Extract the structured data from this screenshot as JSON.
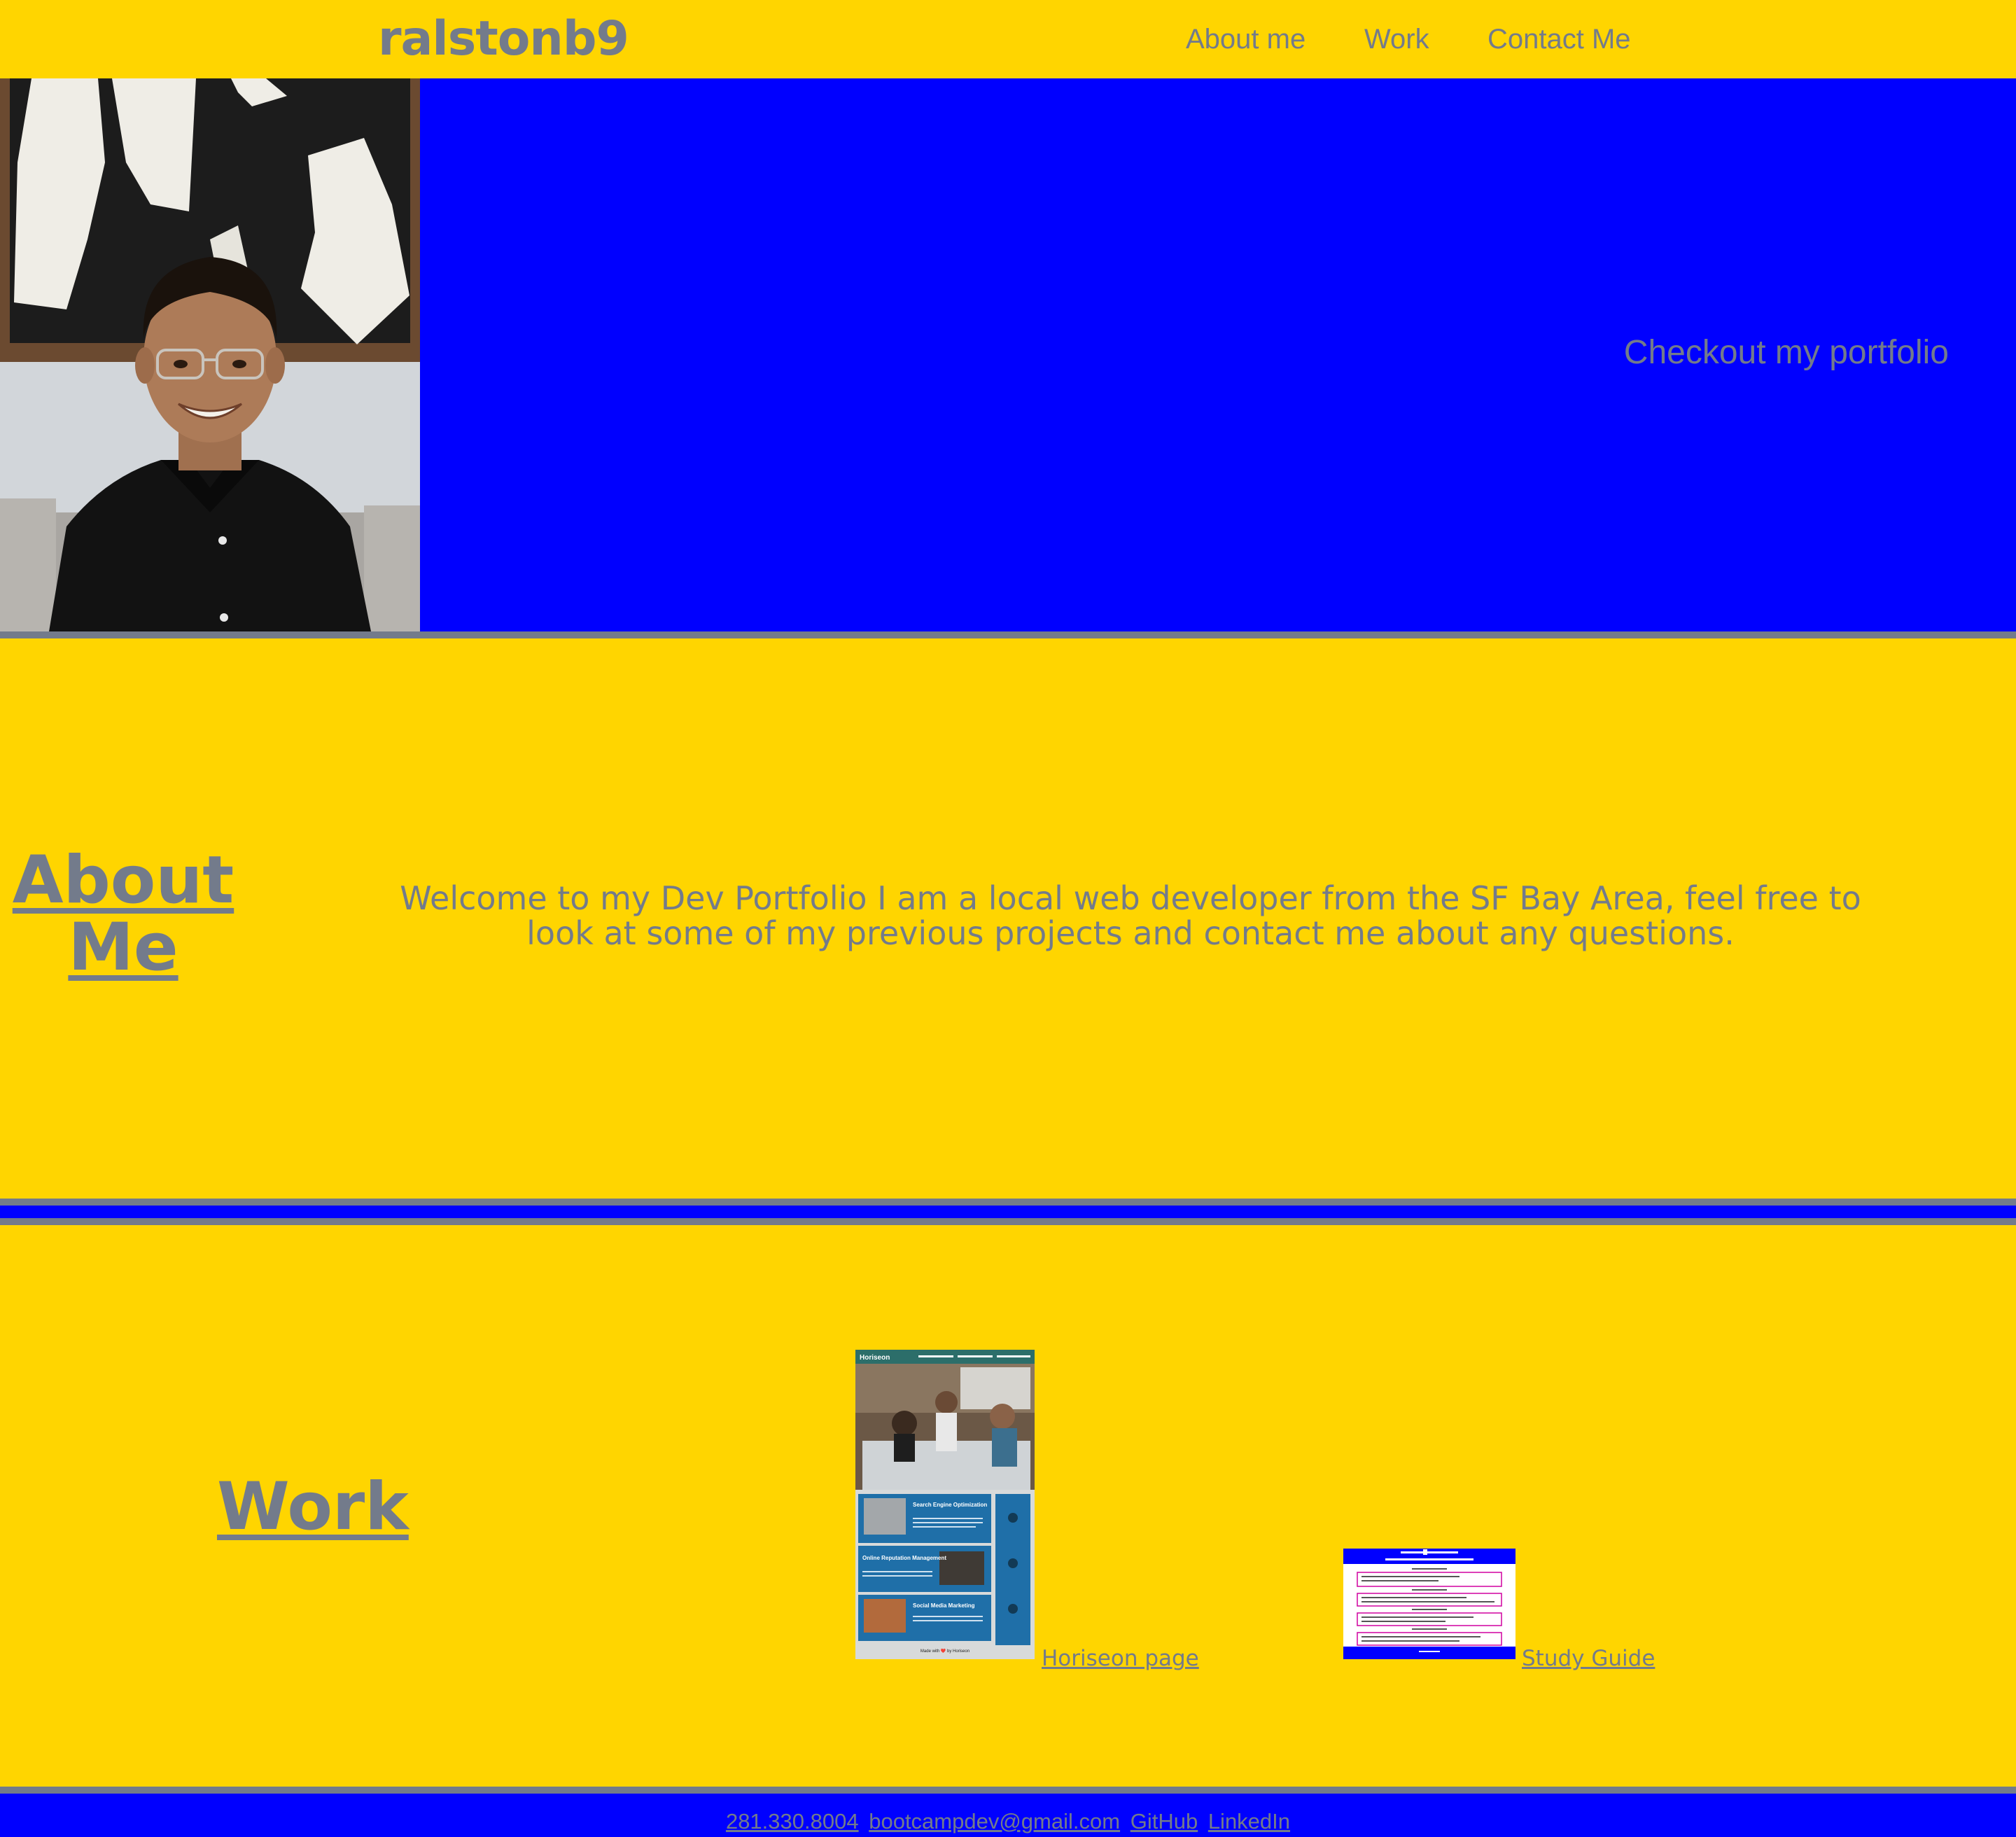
{
  "header": {
    "logo": "ralstonb9",
    "nav": {
      "about": "About me",
      "work": "Work",
      "contact": "Contact Me"
    }
  },
  "hero": {
    "cta": "Checkout my portfolio"
  },
  "about": {
    "heading_line1": "About",
    "heading_line2": "Me",
    "text": "Welcome to my Dev Portfolio I am a local web developer from the SF Bay Area, feel free to look at some of my previous projects and contact me about any questions."
  },
  "work": {
    "heading": "Work",
    "projects": [
      {
        "label": "Horiseon page",
        "thumb": {
          "brand": "Horiseon",
          "cards": [
            "Search Engine Optimization",
            "Online Reputation Management",
            "Social Media Marketing"
          ],
          "footer": "Made with ❤️ by Horiseon"
        }
      },
      {
        "label": "Study Guide"
      }
    ]
  },
  "footer": {
    "phone": "281.330.8004",
    "email": "bootcampdev@gmail.com",
    "github": "GitHub",
    "linkedin": "LinkedIn"
  },
  "colors": {
    "yellow": "#ffd500",
    "blue": "#0000ff",
    "gray": "#737b8b"
  }
}
